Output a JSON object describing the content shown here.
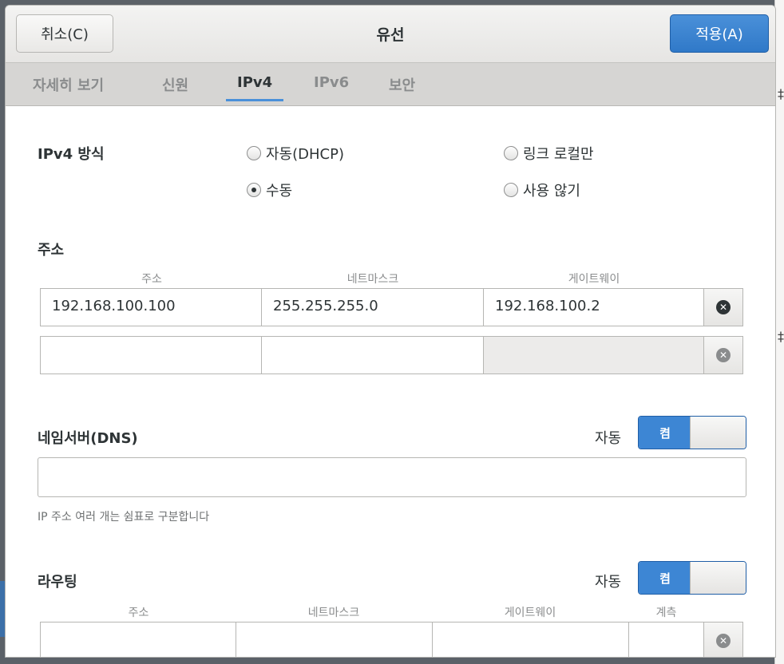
{
  "header": {
    "cancel_label": "취소(C)",
    "title": "유선",
    "apply_label": "적용(A)"
  },
  "tabs": [
    {
      "label": "자세히 보기",
      "active": false
    },
    {
      "label": "신원",
      "active": false
    },
    {
      "label": "IPv4",
      "active": true
    },
    {
      "label": "IPv6",
      "active": false
    },
    {
      "label": "보안",
      "active": false
    }
  ],
  "ipv4_method": {
    "label": "IPv4 방식",
    "options": [
      {
        "label": "자동(DHCP)",
        "checked": false
      },
      {
        "label": "링크 로컬만",
        "checked": false
      },
      {
        "label": "수동",
        "checked": true
      },
      {
        "label": "사용 않기",
        "checked": false
      }
    ]
  },
  "addresses": {
    "label": "주소",
    "columns": [
      "주소",
      "네트마스크",
      "게이트웨이"
    ],
    "rows": [
      {
        "address": "192.168.100.100",
        "netmask": "255.255.255.0",
        "gateway": "192.168.100.2"
      },
      {
        "address": "",
        "netmask": "",
        "gateway": ""
      }
    ]
  },
  "dns": {
    "label": "네임서버(DNS)",
    "auto_label": "자동",
    "switch_label": "켬",
    "value": "",
    "hint": "IP 주소 여러 개는 쉼표로 구분합니다"
  },
  "routing": {
    "label": "라우팅",
    "auto_label": "자동",
    "switch_label": "켬",
    "columns": [
      "주소",
      "네트마스크",
      "게이트웨이",
      "계측"
    ]
  },
  "colors": {
    "accent": "#4a90d9",
    "text": "#2e3436"
  }
}
